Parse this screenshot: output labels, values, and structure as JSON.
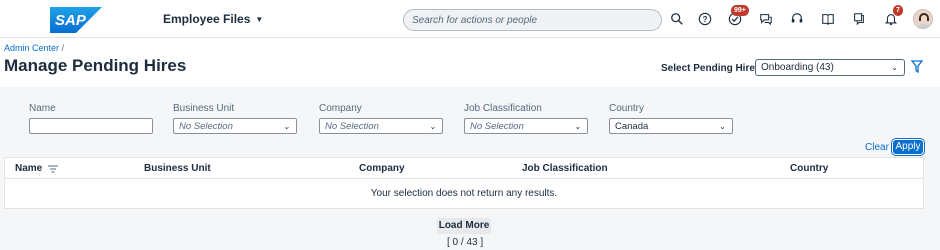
{
  "shell": {
    "logo_text": "SAP",
    "module": "Employee Files",
    "search_placeholder": "Search for actions or people",
    "badges": {
      "todo": "99+",
      "notifications": "7"
    },
    "colors": {
      "brand": "#0a6ed1",
      "badge": "#c0392b"
    },
    "icons": [
      "search-icon",
      "help-icon",
      "todo-icon",
      "feedback-icon",
      "support-icon",
      "guide-icon",
      "notes-icon",
      "notification-icon",
      "avatar"
    ]
  },
  "header": {
    "breadcrumb": "Admin Center",
    "breadcrumb_sep": "/",
    "title": "Manage Pending Hires",
    "select_label": "Select Pending Hires",
    "select_value": "Onboarding (43)"
  },
  "filters": {
    "name": {
      "label": "Name",
      "value": ""
    },
    "business_unit": {
      "label": "Business Unit",
      "value": "No Selection"
    },
    "company": {
      "label": "Company",
      "value": "No Selection"
    },
    "job_classification": {
      "label": "Job Classification",
      "value": "No Selection"
    },
    "country": {
      "label": "Country",
      "value": "Canada"
    },
    "clear_label": "Clear",
    "apply_label": "Apply"
  },
  "table": {
    "columns": [
      "Name",
      "Business Unit",
      "Company",
      "Job Classification",
      "Country"
    ],
    "empty_message": "Your selection does not return any results."
  },
  "footer": {
    "load_more": "Load More",
    "counter": "[ 0 / 43 ]"
  }
}
